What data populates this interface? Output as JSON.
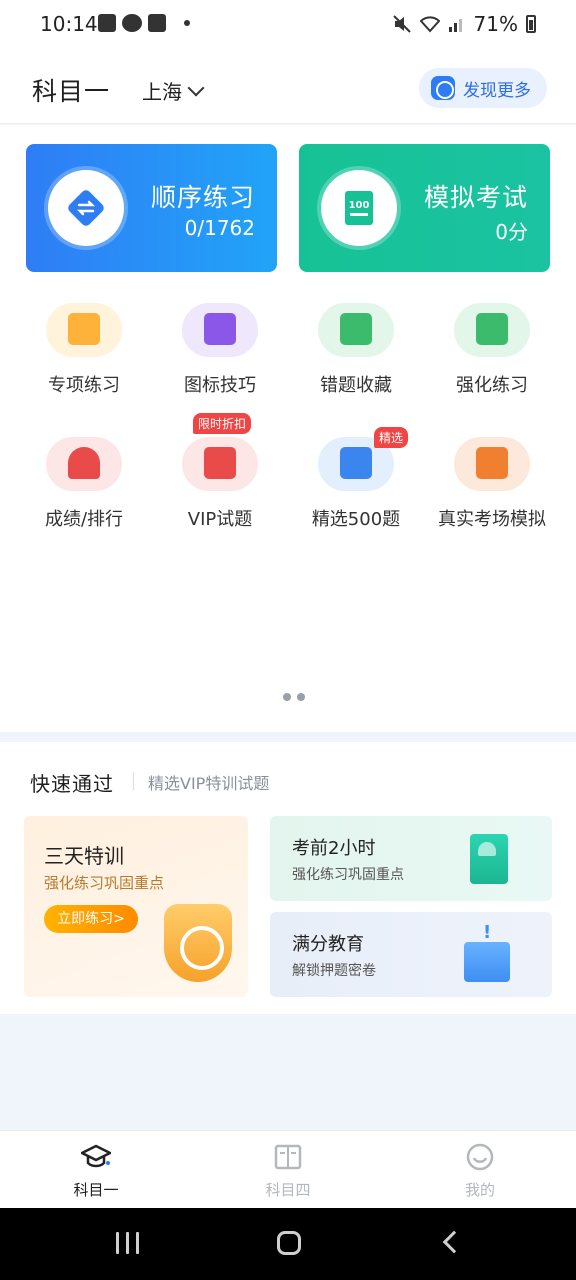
{
  "status_bar": {
    "time": "10:14",
    "battery": "71%",
    "left_icons": [
      "gallery-icon",
      "chat-bubble-icon",
      "checkbox-icon",
      "dot-icon"
    ],
    "right_icons": [
      "mute-icon",
      "wifi-icon",
      "signal-icon",
      "battery-icon"
    ]
  },
  "header": {
    "subject": "科目一",
    "city": "上海",
    "discover_label": "发现更多"
  },
  "main_cards": [
    {
      "title": "顺序练习",
      "sub": "0/1762",
      "color": "#2f7df5"
    },
    {
      "title": "模拟考试",
      "sub": "0分",
      "color": "#16c295"
    }
  ],
  "grid": [
    {
      "label": "专项练习",
      "icon": "folder-zx-icon",
      "bg": "#fff3dc",
      "fg": "#ffb23a"
    },
    {
      "label": "图标技巧",
      "icon": "sign-icon",
      "bg": "#efe7fb",
      "fg": "#8a57e8"
    },
    {
      "label": "错题收藏",
      "icon": "book-icon",
      "bg": "#e2f6ea",
      "fg": "#3dbb6d"
    },
    {
      "label": "强化练习",
      "icon": "archive-icon",
      "bg": "#e2f6ea",
      "fg": "#3dbb6d"
    },
    {
      "label": "成绩/排行",
      "icon": "grad-cap-icon",
      "bg": "#fde6e6",
      "fg": "#e94a4a"
    },
    {
      "label": "VIP试题",
      "icon": "crown-icon",
      "bg": "#fde6e6",
      "fg": "#e94a4a",
      "tag": "限时折扣"
    },
    {
      "label": "精选500题",
      "icon": "500-icon",
      "bg": "#e3effd",
      "fg": "#3b86ee",
      "tag": "精选"
    },
    {
      "label": "真实考场模拟",
      "icon": "monitor-icon",
      "bg": "#fde8dc",
      "fg": "#f08030"
    }
  ],
  "quick": {
    "title": "快速通过",
    "subtitle": "精选VIP特训试题",
    "left_card": {
      "title": "三天特训",
      "sub": "强化练习巩固重点",
      "button": "立即练习>"
    },
    "cards": [
      {
        "title": "考前2小时",
        "sub": "强化练习巩固重点"
      },
      {
        "title": "满分教育",
        "sub": "解锁押题密卷"
      }
    ]
  },
  "tabs": [
    {
      "label": "科目一",
      "active": true
    },
    {
      "label": "科目四",
      "active": false
    },
    {
      "label": "我的",
      "active": false
    }
  ]
}
